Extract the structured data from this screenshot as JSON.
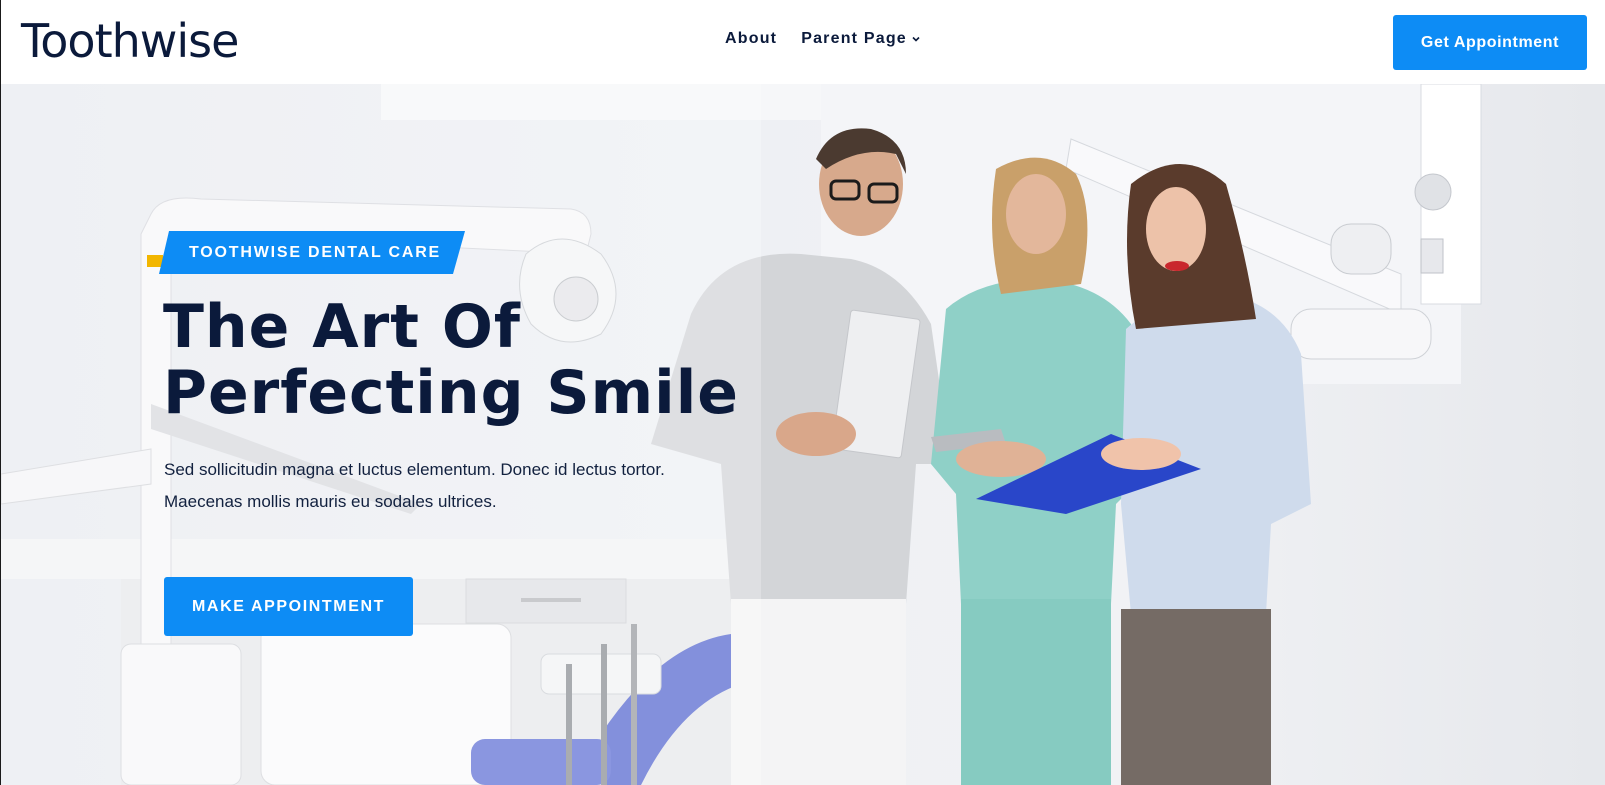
{
  "colors": {
    "brand": "#0d8cf5",
    "heading": "#0b1a3b",
    "accent_yellow": "#f2b600"
  },
  "header": {
    "logo": "Toothwise",
    "nav": [
      {
        "label": "About"
      },
      {
        "label": "Parent Page",
        "icon": "chevron-down-icon"
      }
    ],
    "cta_label": "Get Appointment"
  },
  "hero": {
    "badge": "TOOTHWISE DENTAL CARE",
    "headline": [
      "The Art Of",
      "Perfecting Smile"
    ],
    "description": [
      "Sed sollicitudin magna et luctus elementum. Donec id lectus tortor.",
      "Maecenas mollis mauris eu sodales ultrices."
    ],
    "button_label": "MAKE APPOINTMENT",
    "image": "dental-team-photo"
  }
}
